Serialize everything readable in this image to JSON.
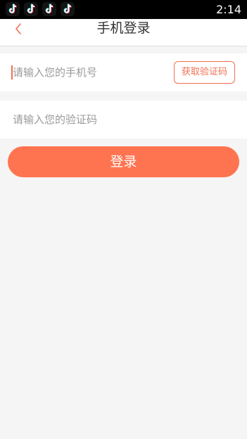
{
  "status_bar": {
    "time": "2:14",
    "notification_icons": [
      "tiktok-icon",
      "tiktok-icon",
      "tiktok-icon",
      "tiktok-icon"
    ]
  },
  "header": {
    "title": "手机登录",
    "back_icon": "chevron-left-icon"
  },
  "phone_field": {
    "placeholder": "请输入您的手机号",
    "value": ""
  },
  "get_code_button": {
    "label": "获取验证码"
  },
  "code_field": {
    "placeholder": "请输入您的验证码",
    "value": ""
  },
  "login_button": {
    "label": "登录"
  },
  "colors": {
    "accent": "#ff7450",
    "page_background": "#f5f5f5",
    "status_bar": "#000000"
  }
}
